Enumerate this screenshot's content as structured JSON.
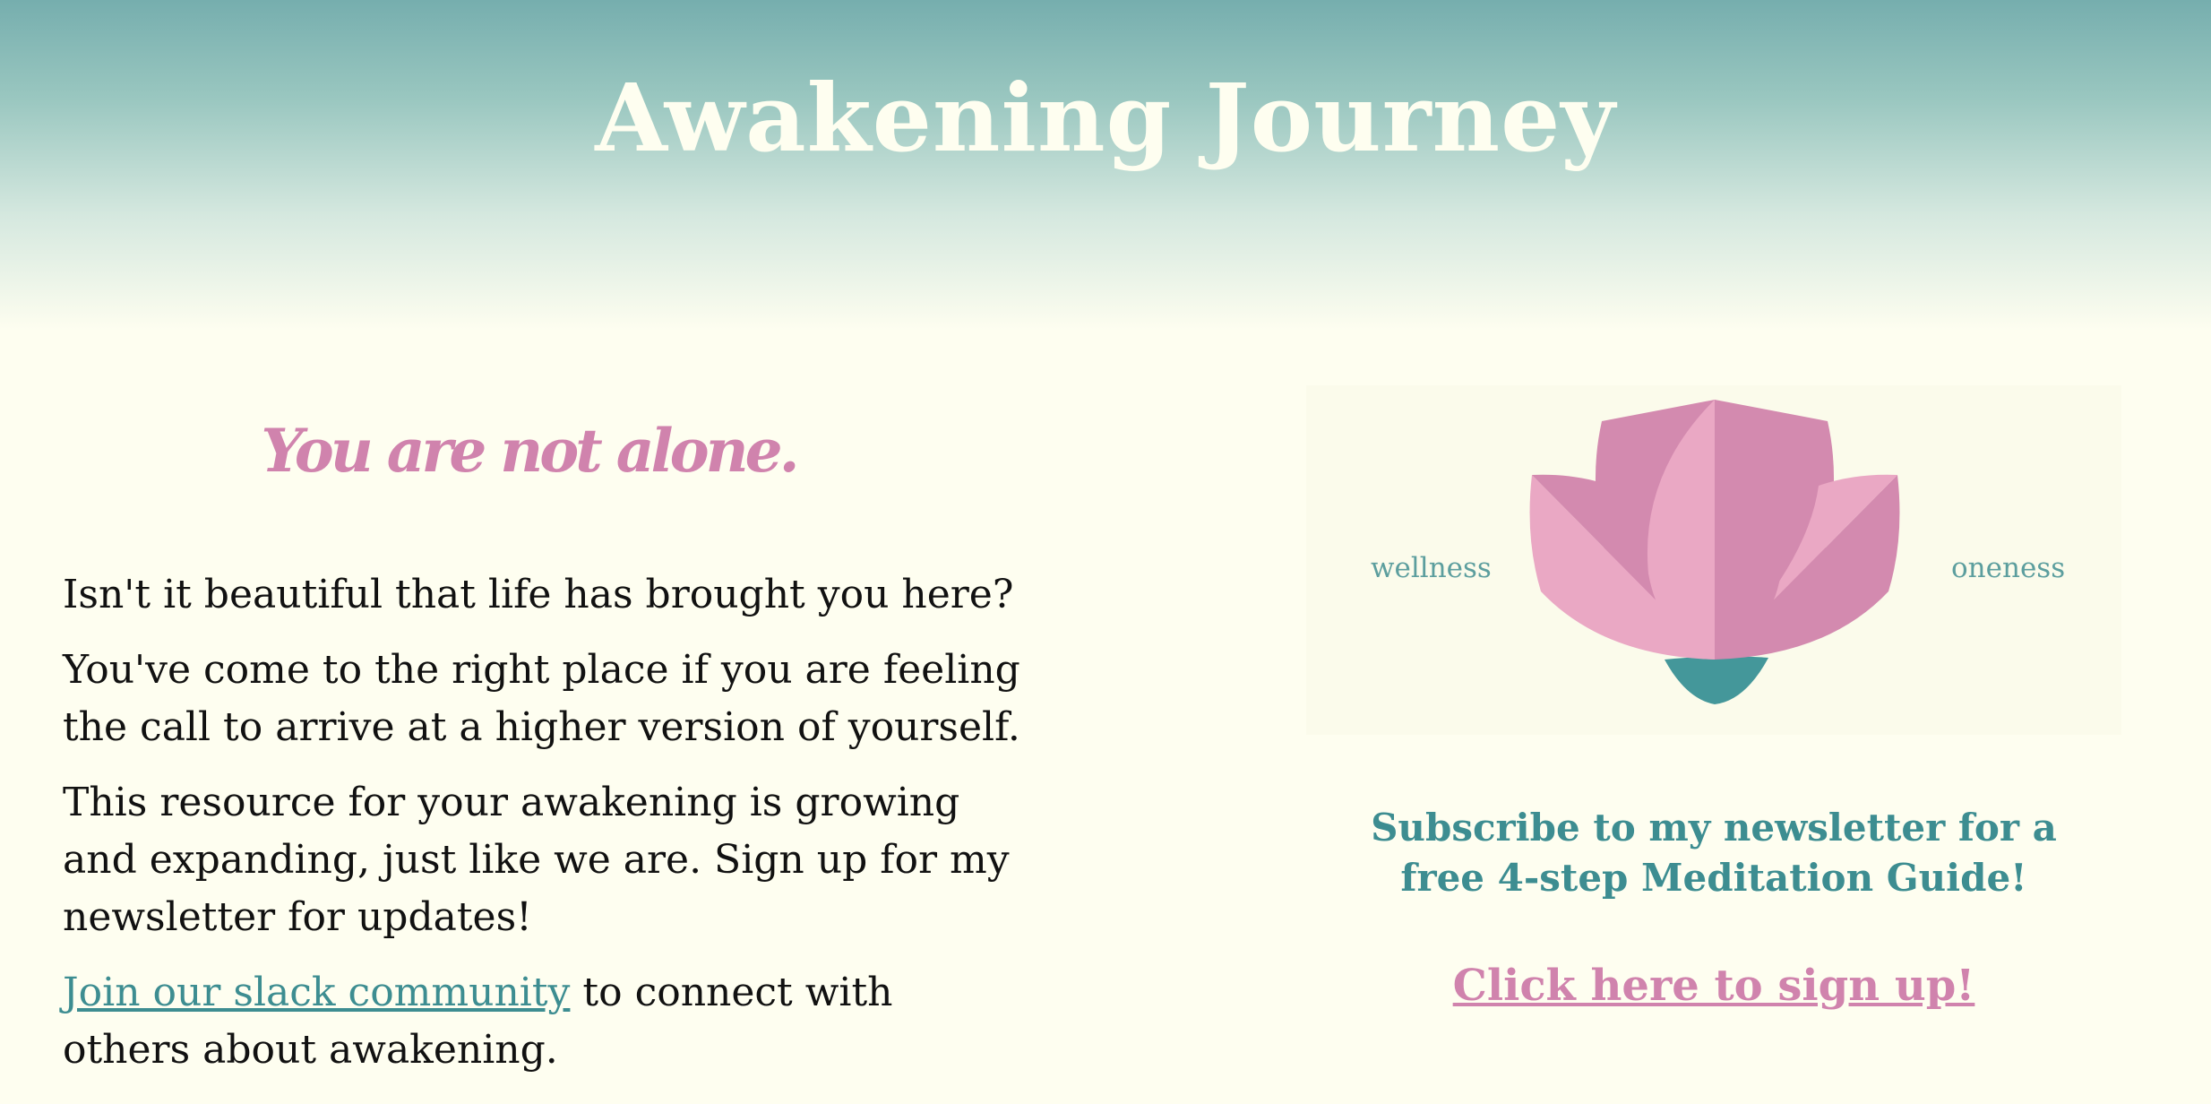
{
  "header": {
    "title": "Awakening Journey"
  },
  "main": {
    "tagline": "You are not alone.",
    "paragraphs": [
      "Isn't it beautiful that life has brought you here?",
      "You've come to the right place if you are feeling the call to arrive at a higher version of yourself.",
      "This resource for your awakening is growing and expanding, just like we are. Sign up for my newsletter for updates!"
    ],
    "slack_link": "Join our slack community",
    "slack_suffix": " to connect with others about awakening."
  },
  "sidebar": {
    "word_left": "wellness",
    "word_right": "oneness",
    "subscribe_text": "Subscribe to my newsletter for a free 4-step Meditation Guide!",
    "signup_link": "Click here to sign up!"
  },
  "colors": {
    "background": "#fefef0",
    "header_top": "#76aeae",
    "accent_teal": "#3d8d91",
    "accent_pink": "#d083ad",
    "petal_light": "#eaa8c4",
    "petal_dark": "#d38aaf"
  },
  "icons": {
    "logo": "lotus-logo-icon"
  }
}
